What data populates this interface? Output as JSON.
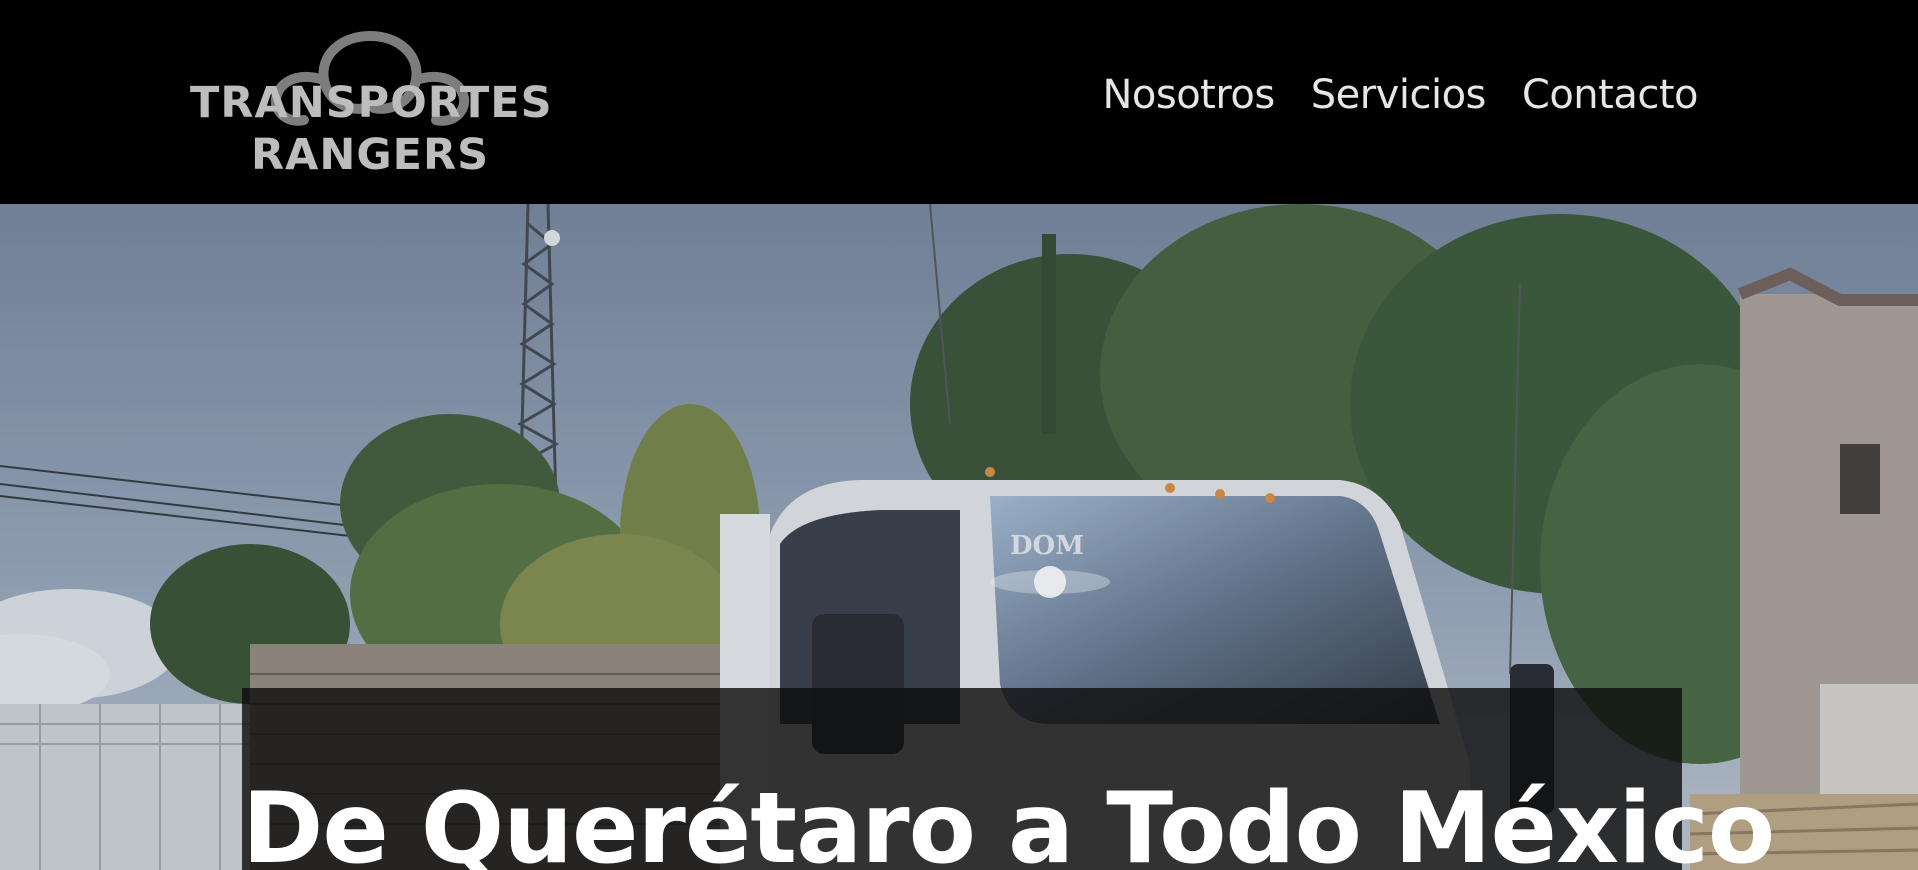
{
  "brand": {
    "line1": "TRANSPORTES",
    "line2": "RANGERS"
  },
  "nav": {
    "items": [
      {
        "label": "Nosotros"
      },
      {
        "label": "Servicios"
      },
      {
        "label": "Contacto"
      }
    ]
  },
  "hero": {
    "title": "De Querétaro a Todo México"
  },
  "colors": {
    "header_bg": "#000000",
    "nav_text": "#e6e6e6",
    "logo_text": "#bdbdbd",
    "banner_bg": "#0f0f0f",
    "banner_text": "#ffffff"
  }
}
